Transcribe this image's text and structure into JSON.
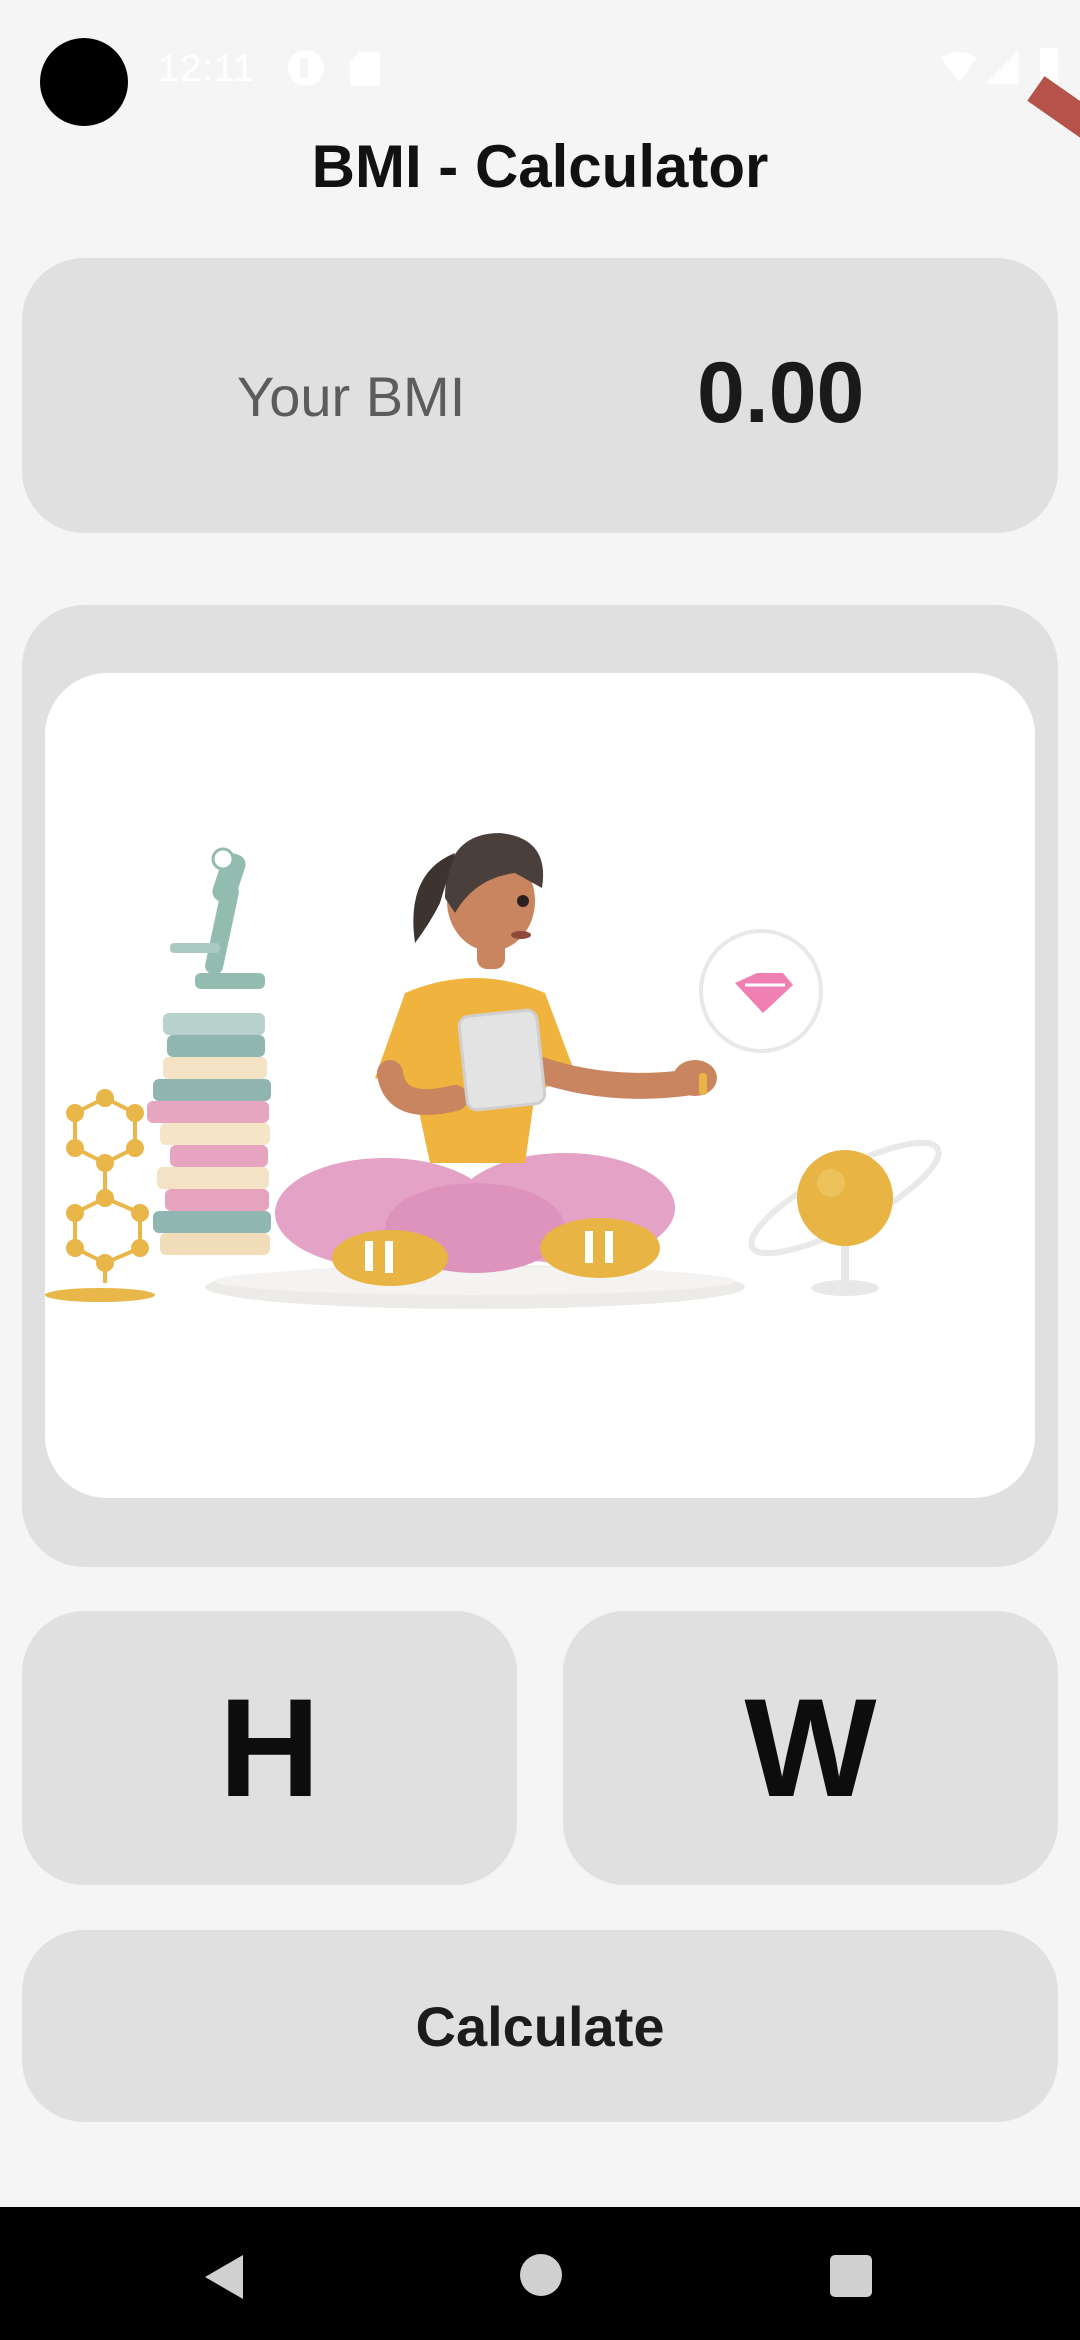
{
  "status_bar": {
    "time": "12:11"
  },
  "header": {
    "title": "BMI - Calculator"
  },
  "result": {
    "label": "Your BMI",
    "value": "0.00"
  },
  "illustration": {
    "alt": "person-with-books-illustration"
  },
  "inputs": {
    "height_label": "H",
    "weight_label": "W"
  },
  "actions": {
    "calculate_label": "Calculate"
  },
  "nav": {
    "back_icon": "back-triangle-icon",
    "home_icon": "home-circle-icon",
    "recents_icon": "recents-square-icon"
  },
  "colors": {
    "background": "#f5f5f5",
    "card": "#e0e0e0",
    "accent_ribbon": "#b5524a"
  }
}
